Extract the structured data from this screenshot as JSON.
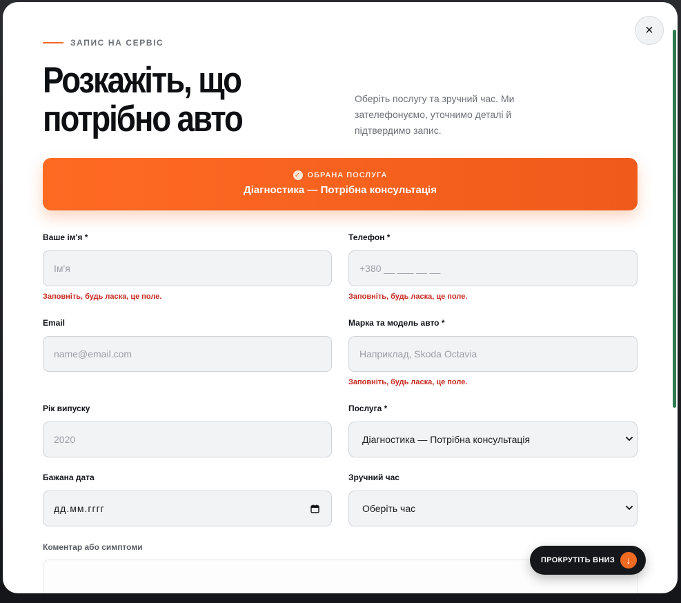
{
  "header": {
    "eyebrow": "ЗАПИС НА СЕРВІС",
    "title_line1": "Розкажіть, що",
    "title_line2": "потрібно авто",
    "subtitle": "Оберіть послугу та зручний час. Ми зателефонуємо, уточнимо деталі й підтвердимо запис.",
    "close_label": "×"
  },
  "banner": {
    "check_glyph": "✓",
    "label": "ОБРАНА ПОСЛУГА",
    "service": "Діагностика — Потрібна консультація"
  },
  "form": {
    "name": {
      "label": "Ваше ім'я *",
      "placeholder": "Ім'я",
      "error": "Заповніть, будь ласка, це поле."
    },
    "phone": {
      "label": "Телефон *",
      "placeholder": "+380 __ ___ __ __",
      "error": "Заповніть, будь ласка, це поле."
    },
    "email": {
      "label": "Email",
      "placeholder": "name@email.com"
    },
    "car": {
      "label": "Марка та модель авто *",
      "placeholder": "Наприклад, Skoda Octavia",
      "error": "Заповніть, будь ласка, це поле."
    },
    "year": {
      "label": "Рік випуску",
      "placeholder": "2020"
    },
    "service": {
      "label": "Послуга *",
      "value": "Діагностика — Потрібна консультація"
    },
    "date": {
      "label": "Бажана дата",
      "value": "дд.мм.гггг"
    },
    "time": {
      "label": "Зручний час",
      "value": "Оберіть час"
    },
    "comment": {
      "label": "Коментар або симптоми"
    }
  },
  "scroll_button": {
    "label": "ПРОКРУТІТЬ ВНИЗ",
    "arrow_glyph": "↓"
  },
  "colors": {
    "accent": "#f06a22",
    "error": "#c62b20",
    "dark": "#16171b",
    "scrollbar": "#2f7a4f"
  }
}
